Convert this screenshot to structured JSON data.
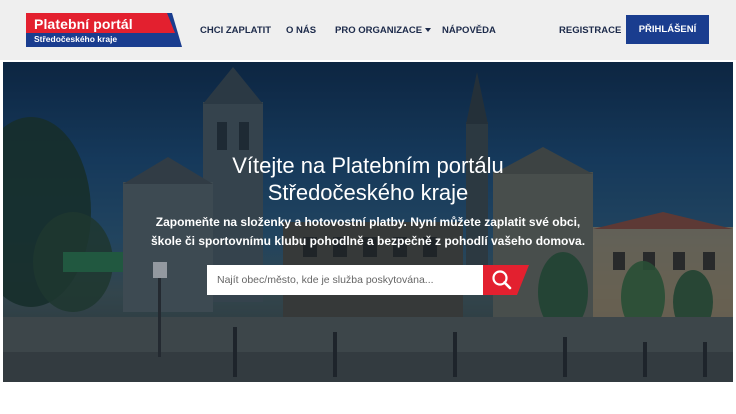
{
  "header": {
    "logo": {
      "title": "Platební portál",
      "subtitle": "Středočeského kraje"
    },
    "nav": [
      {
        "label": "CHCI ZAPLATIT"
      },
      {
        "label": "O NÁS"
      },
      {
        "label": "PRO ORGANIZACE",
        "has_dropdown": true
      },
      {
        "label": "NÁPOVĚDA"
      }
    ],
    "register_label": "REGISTRACE",
    "login_label": "PŘIHLÁŠENÍ"
  },
  "hero": {
    "title_line1": "Vítejte na Platebním portálu",
    "title_line2": "Středočeského kraje",
    "text_line1": "Zapomeňte na složenky a hotovostní platby. Nyní můžete zaplatit své obci,",
    "text_line2": "škole či sportovnímu klubu pohodlně a bezpečně z pohodlí vašeho domova.",
    "search_placeholder": "Najít obec/město, kde je služba poskytována...",
    "search_icon": "search-icon"
  },
  "colors": {
    "brand_red": "#e3202f",
    "brand_blue": "#1a3d8f",
    "nav_text": "#1c2a4a",
    "header_bg": "#efefef"
  }
}
